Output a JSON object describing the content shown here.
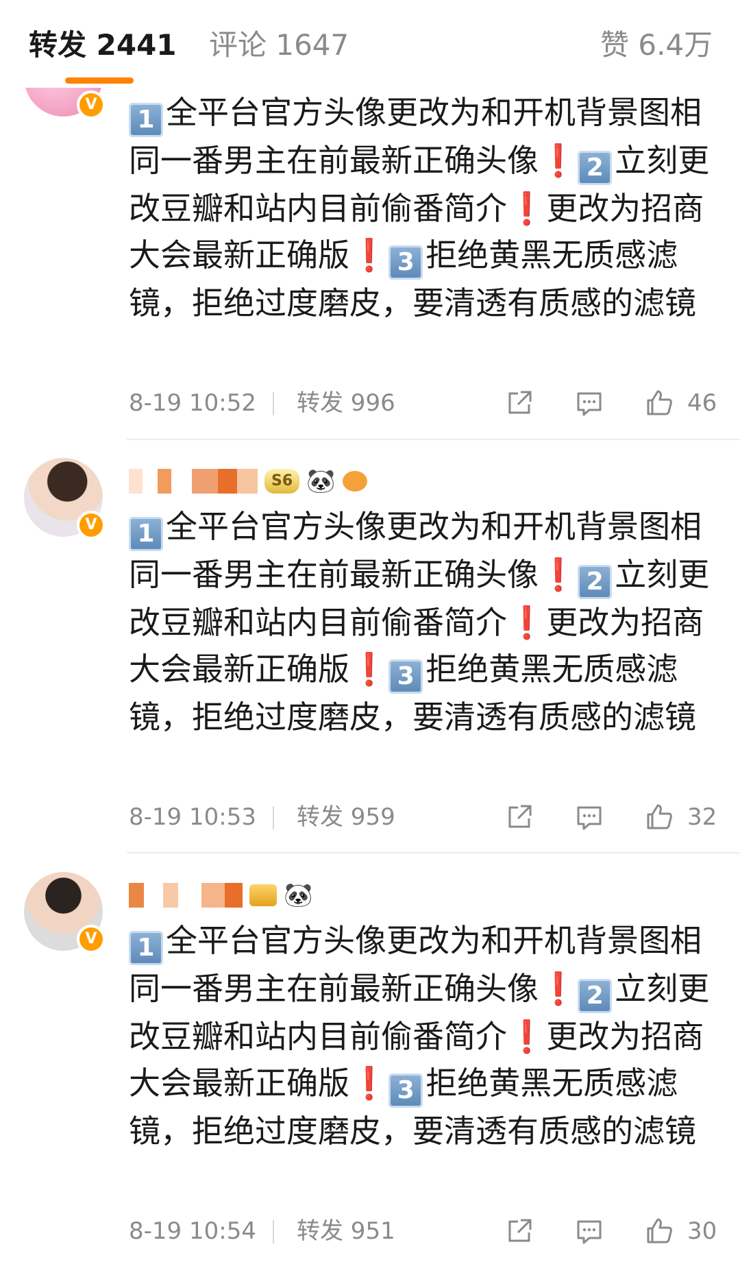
{
  "tabs": [
    {
      "label": "转发 2441",
      "active": true
    },
    {
      "label": "评论 1647",
      "active": false
    },
    {
      "label": "赞 6.4万",
      "active": false
    }
  ],
  "colors": {
    "accent": "#ff8200",
    "verified_badge": "#ff9d00",
    "exclamation": "#e0322c",
    "meta_text": "#8a8a8a"
  },
  "posts": [
    {
      "content": {
        "part1": "全平台官方头像更改为和开机背景图相同一番男主在前最新正确头像",
        "part2": "立刻更改豆瓣和站内目前偷番简介",
        "part3": "更改为招商大会最新正确版",
        "part4": "拒绝黄黑无质感滤镜，拒绝过度磨皮，要清透有质感的滤镜"
      },
      "time": "8-19 10:52",
      "repost": "转发 996",
      "likes": "46"
    },
    {
      "content": {
        "part1": "全平台官方头像更改为和开机背景图相同一番男主在前最新正确头像",
        "part2": "立刻更改豆瓣和站内目前偷番简介",
        "part3": "更改为招商大会最新正确版",
        "part4": "拒绝黄黑无质感滤镜，拒绝过度磨皮，要清透有质感的滤镜"
      },
      "time": "8-19 10:53",
      "repost": "转发 959",
      "likes": "32"
    },
    {
      "content": {
        "part1": "全平台官方头像更改为和开机背景图相同一番男主在前最新正确头像",
        "part2": "立刻更改豆瓣和站内目前偷番简介",
        "part3": "更改为招商大会最新正确版",
        "part4": "拒绝黄黑无质感滤镜，拒绝过度磨皮，要清透有质感的滤镜"
      },
      "time": "8-19 10:54",
      "repost": "转发 951",
      "likes": "30"
    }
  ],
  "keycaps": {
    "one": "1",
    "two": "2",
    "three": "3"
  },
  "badges": {
    "verified": "V",
    "level": "S6",
    "panda": "🐼"
  }
}
